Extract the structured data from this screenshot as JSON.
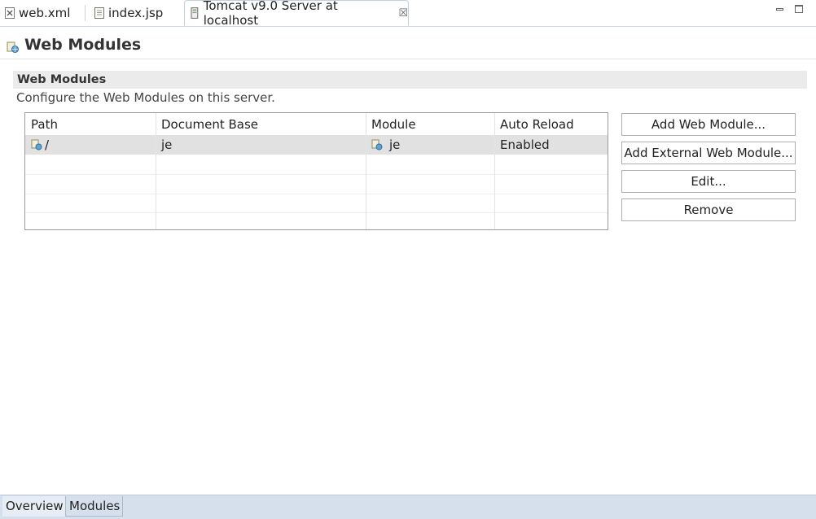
{
  "editor_tabs": [
    {
      "label": "web.xml",
      "icon": "xml-file-icon",
      "active": false
    },
    {
      "label": "index.jsp",
      "icon": "jsp-file-icon",
      "active": false
    },
    {
      "label": "Tomcat v9.0 Server at localhost",
      "icon": "server-icon",
      "active": true,
      "close_icon": "close-icon"
    }
  ],
  "window_controls": [
    "minimize-icon",
    "maximize-icon"
  ],
  "page": {
    "title": "Web Modules",
    "title_icon": "web-module-icon"
  },
  "section": {
    "title": "Web Modules",
    "description": "Configure the Web Modules on this server."
  },
  "table": {
    "columns": [
      "Path",
      "Document Base",
      "Module",
      "Auto Reload"
    ],
    "rows": [
      {
        "path": "/",
        "document_base": "je",
        "module": "je",
        "auto_reload": "Enabled",
        "selected": true
      }
    ]
  },
  "buttons": {
    "add_web_module": "Add Web Module...",
    "add_external_web_module": "Add External Web Module...",
    "edit": "Edit...",
    "remove": "Remove"
  },
  "page_tabs": [
    {
      "label": "Overview",
      "active": false
    },
    {
      "label": "Modules",
      "active": true
    }
  ],
  "colors": {
    "tab_bar_border": "#cfd9e7",
    "section_bar": "#ebebeb",
    "selected_row": "#e1e1e1",
    "bottom_bar": "#d6e0ec"
  }
}
